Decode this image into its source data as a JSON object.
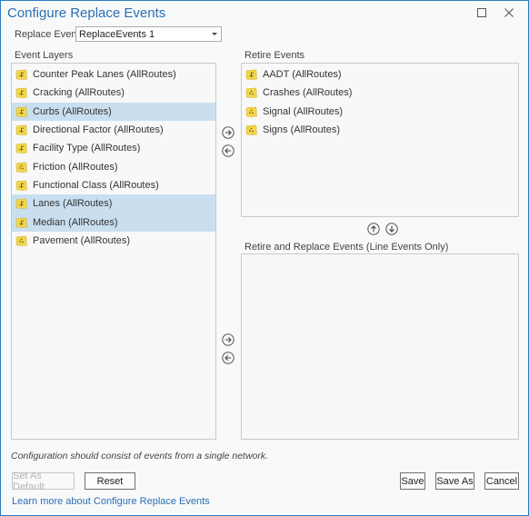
{
  "window": {
    "title": "Configure Replace Events",
    "maximize_icon": "maximize-icon",
    "close_icon": "close-icon"
  },
  "replace_events": {
    "label": "Replace Events",
    "selected": "ReplaceEvents 1"
  },
  "event_layers": {
    "label": "Event Layers",
    "items": [
      {
        "label": "Counter Peak Lanes (AllRoutes)",
        "type": "line",
        "selected": false
      },
      {
        "label": "Cracking (AllRoutes)",
        "type": "line",
        "selected": false
      },
      {
        "label": "Curbs (AllRoutes)",
        "type": "line",
        "selected": true
      },
      {
        "label": "Directional Factor (AllRoutes)",
        "type": "line",
        "selected": false
      },
      {
        "label": "Facility Type (AllRoutes)",
        "type": "line",
        "selected": false
      },
      {
        "label": "Friction (AllRoutes)",
        "type": "point",
        "selected": false
      },
      {
        "label": "Functional Class (AllRoutes)",
        "type": "line",
        "selected": false
      },
      {
        "label": "Lanes (AllRoutes)",
        "type": "line",
        "selected": true
      },
      {
        "label": "Median (AllRoutes)",
        "type": "line",
        "selected": true
      },
      {
        "label": "Pavement (AllRoutes)",
        "type": "point",
        "selected": false
      }
    ]
  },
  "retire_events": {
    "label": "Retire Events",
    "items": [
      {
        "label": "AADT (AllRoutes)",
        "type": "line",
        "selected": false
      },
      {
        "label": "Crashes (AllRoutes)",
        "type": "point",
        "selected": false
      },
      {
        "label": "Signal (AllRoutes)",
        "type": "point",
        "selected": false
      },
      {
        "label": "Signs (AllRoutes)",
        "type": "point",
        "selected": false
      }
    ]
  },
  "retire_replace_events": {
    "label": "Retire and Replace Events (Line Events Only)",
    "items": []
  },
  "icons": {
    "add_right": "arrow-right-circle-icon",
    "remove_left": "arrow-left-circle-icon",
    "move_up": "arrow-up-circle-icon",
    "move_down": "arrow-down-circle-icon"
  },
  "note": "Configuration should consist of events from a single network.",
  "buttons": {
    "set_default": "Set As Default",
    "reset": "Reset",
    "save": "Save",
    "save_as": "Save As",
    "cancel": "Cancel"
  },
  "link": "Learn more about Configure Replace Events",
  "colors": {
    "accent": "#2a6fb4",
    "selection": "#c9dff0",
    "layer_icon": "#f2d64b"
  }
}
